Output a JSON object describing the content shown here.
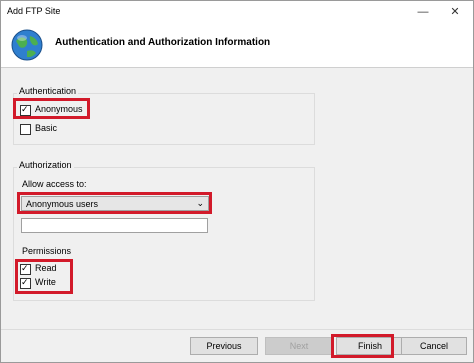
{
  "window": {
    "title": "Add FTP Site"
  },
  "titlebar": {
    "minimize": "—",
    "close": "✕"
  },
  "header": {
    "title": "Authentication and Authorization Information",
    "icon": "globe-icon"
  },
  "authentication": {
    "legend": "Authentication",
    "options": [
      {
        "label": "Anonymous",
        "checked": true
      },
      {
        "label": "Basic",
        "checked": false
      }
    ]
  },
  "authorization": {
    "legend": "Authorization",
    "allow_label": "Allow access to:",
    "allow_value": "Anonymous users",
    "text_value": ""
  },
  "permissions": {
    "legend": "Permissions",
    "options": [
      {
        "label": "Read",
        "checked": true
      },
      {
        "label": "Write",
        "checked": true
      }
    ]
  },
  "buttons": {
    "previous": "Previous",
    "next": "Next",
    "finish": "Finish",
    "cancel": "Cancel"
  },
  "colors": {
    "highlight": "#d21a2a",
    "background": "#f0f0f0"
  },
  "glyphs": {
    "check": "✓",
    "dropdown": "⌄"
  }
}
